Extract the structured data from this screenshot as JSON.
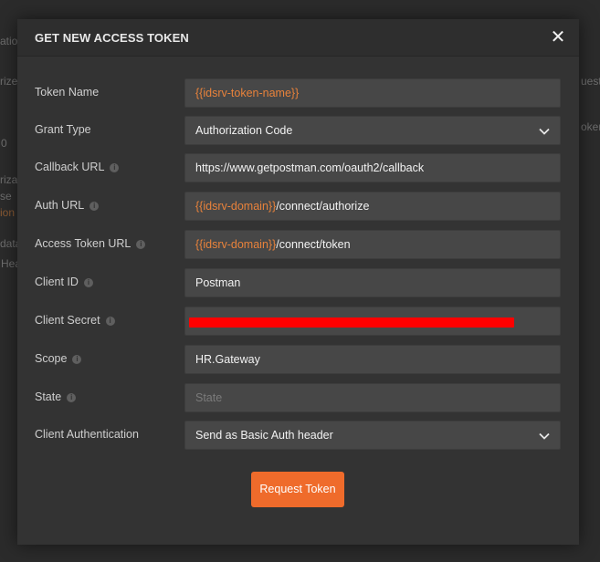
{
  "background": {
    "fragments": [
      {
        "text": "atio",
        "orange": false
      },
      {
        "text": "rize",
        "orange": false
      },
      {
        "text": "uest",
        "orange": false
      },
      {
        "text": "0",
        "orange": false
      },
      {
        "text": "oken",
        "orange": false
      },
      {
        "text": "riza",
        "orange": false
      },
      {
        "text": "se",
        "orange": false
      },
      {
        "text": "ion",
        "orange": true
      },
      {
        "text": "data",
        "orange": false
      },
      {
        "text": "Hea",
        "orange": false
      }
    ]
  },
  "modal": {
    "title": "GET NEW ACCESS TOKEN",
    "close_glyph": "✕"
  },
  "fields": {
    "token_name": {
      "label": "Token Name",
      "value": "{{idsrv-token-name}}"
    },
    "grant_type": {
      "label": "Grant Type",
      "value": "Authorization Code"
    },
    "callback_url": {
      "label": "Callback URL",
      "value": "https://www.getpostman.com/oauth2/callback"
    },
    "auth_url": {
      "label": "Auth URL",
      "var": "{{idsrv-domain}}",
      "value": "/connect/authorize"
    },
    "access_token_url": {
      "label": "Access Token URL",
      "var": "{{idsrv-domain}}",
      "value": "/connect/token"
    },
    "client_id": {
      "label": "Client ID",
      "value": "Postman"
    },
    "client_secret": {
      "label": "Client Secret",
      "value": ""
    },
    "scope": {
      "label": "Scope",
      "value": "HR.Gateway"
    },
    "state": {
      "label": "State",
      "value": "",
      "placeholder": "State"
    },
    "client_auth": {
      "label": "Client Authentication",
      "value": "Send as Basic Auth header"
    }
  },
  "info_glyph": "i",
  "request_button": {
    "label": "Request Token"
  },
  "colors": {
    "accent": "#ef6b2b",
    "variable": "#e8823b",
    "redaction": "#ff0000"
  }
}
